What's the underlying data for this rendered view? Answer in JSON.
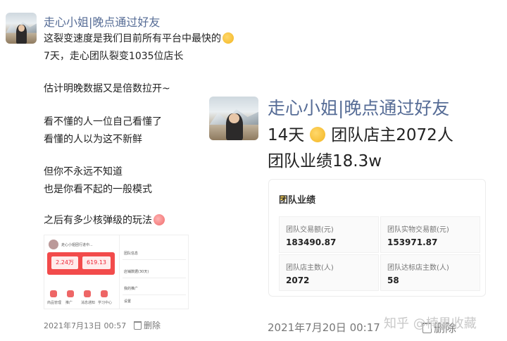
{
  "post1": {
    "name": "走心小姐|晚点通过好友",
    "lines": [
      "这裂变速度是我们目前所有平台中最快的",
      "7天，走心团队裂变1035位店长",
      "估计明晚数据又是倍数拉开~",
      "看不懂的人一位自己看懂了",
      "看懂的人以为这不新鲜",
      "但你不永远不知道",
      "也是你看不起的一般模式",
      "之后有多少核弹级的玩法"
    ],
    "thumbnail": {
      "title": "走心小姐团行进中...",
      "stat1": "2.24万",
      "stat2": "619.13",
      "icons": [
        "商品管理",
        "推广",
        "消息通知",
        "学习中心"
      ],
      "rows": [
        "团队信息",
        "店铺数据(30天)",
        "我的推广",
        "设置"
      ]
    },
    "time": "2021年7月13日 00:57",
    "delete": "删除"
  },
  "post2": {
    "name": "走心小姐|晚点通过好友",
    "line1_a": "14天",
    "line1_b": "团队店主2072人",
    "line2": "团队业绩18.3w",
    "card": {
      "title": "团队业绩",
      "cells": [
        {
          "label": "团队交易额(元)",
          "value": "183490.87"
        },
        {
          "label": "团队实物交易额(元)",
          "value": "153971.87"
        },
        {
          "label": "团队店主数(人)",
          "value": "2072"
        },
        {
          "label": "团队达标店主数(人)",
          "value": "58"
        }
      ]
    },
    "time": "2021年7月20日 00:17",
    "delete": "删除"
  },
  "watermark": "知乎 @楠果收藏"
}
